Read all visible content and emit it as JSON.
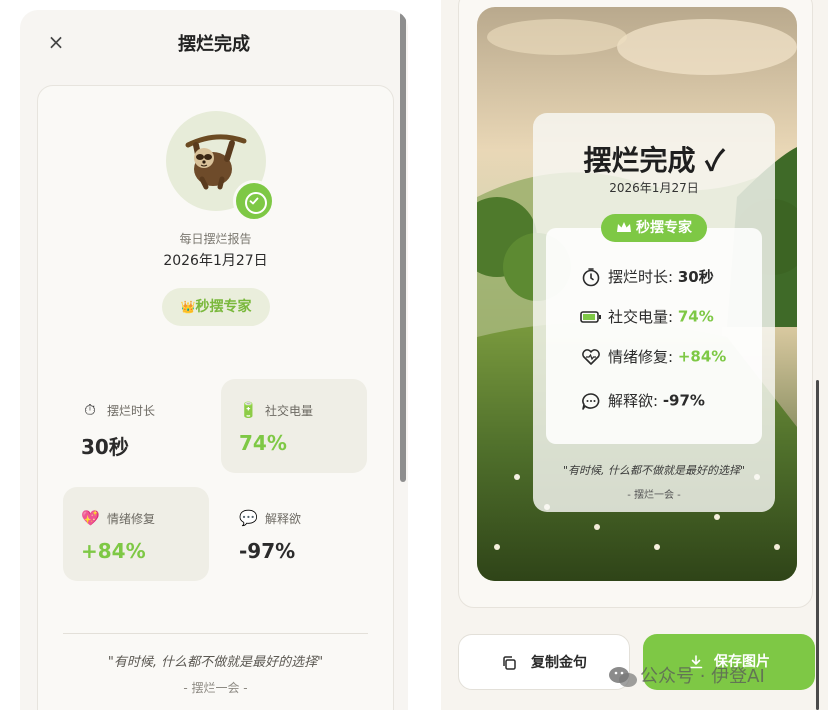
{
  "left": {
    "close_glyph": "×",
    "title": "摆烂完成",
    "report_label": "每日摆烂报告",
    "date": "2026年1月27日",
    "rank": "秒摆专家",
    "rank_crown": "👑",
    "stats": [
      {
        "icon": "stopwatch-icon",
        "glyph": "⏱",
        "label": "摆烂时长",
        "value": "30秒",
        "value_color": "dark"
      },
      {
        "icon": "battery-icon",
        "glyph": "🔋",
        "label": "社交电量",
        "value": "74%",
        "value_color": "green"
      },
      {
        "icon": "heart-icon",
        "glyph": "💖",
        "label": "情绪修复",
        "value": "+84%",
        "value_color": "green"
      },
      {
        "icon": "speech-bubble-icon",
        "glyph": "💬",
        "label": "解释欲",
        "value": "-97%",
        "value_color": "dark"
      }
    ],
    "quote": "\"有时候, 什么都不做就是最好的选择\"",
    "author": "- 摆烂一会 -"
  },
  "right": {
    "title": "摆烂完成",
    "title_mark": "✓",
    "date": "2026年1月27日",
    "rank": "秒摆专家",
    "rows": [
      {
        "icon": "stopwatch-icon",
        "label": "摆烂时长: ",
        "value": "30秒",
        "green": false
      },
      {
        "icon": "battery-icon",
        "label": "社交电量: ",
        "value": "74%",
        "green": true
      },
      {
        "icon": "heart-icon",
        "label": "情绪修复: ",
        "value": "+84%",
        "green": true
      },
      {
        "icon": "speech-bubble-icon",
        "label": "解释欲: ",
        "value": "-97%",
        "green": false
      }
    ],
    "quote": "\"有时候, 什么都不做就是最好的选择\"",
    "author": "- 摆烂一会 -",
    "copy_button": "复制金句",
    "save_button": "保存图片"
  },
  "watermark": "公众号 · 伊登AI",
  "colors": {
    "accent_green": "#7ec845",
    "background": "#f7f5f2",
    "text_dark": "#2b2b2b"
  }
}
